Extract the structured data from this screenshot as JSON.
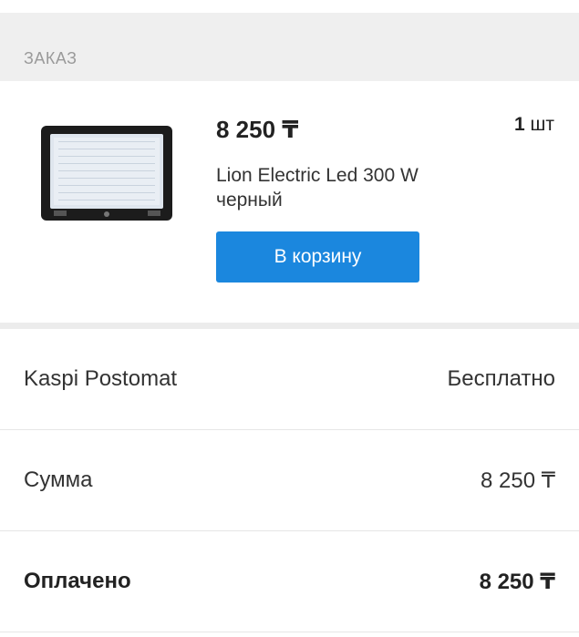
{
  "order_section": {
    "title": "ЗАКАЗ"
  },
  "item": {
    "price": "8 250 ₸",
    "quantity_number": "1",
    "quantity_unit": "шт",
    "name": "Lion Electric Led 300 W черный",
    "image_icon": "floodlight-product-image",
    "cart_button_label": "В корзину"
  },
  "summary": {
    "delivery": {
      "label": "Kaspi Postomat",
      "value": "Бесплатно"
    },
    "sum": {
      "label": "Сумма",
      "value": "8 250 ₸"
    },
    "paid": {
      "label": "Оплачено",
      "value": "8 250 ₸"
    }
  },
  "colors": {
    "accent": "#1b87de",
    "header_bg": "#efefef",
    "header_text": "#9a9a9a"
  }
}
